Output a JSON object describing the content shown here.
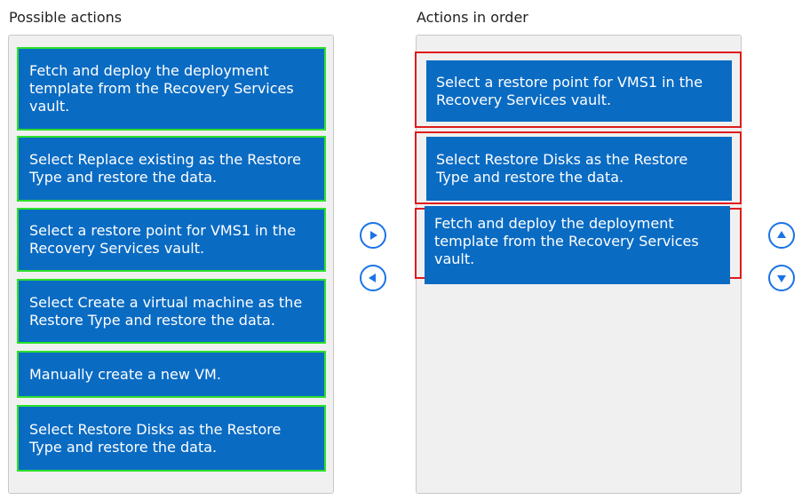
{
  "left": {
    "heading": "Possible actions",
    "items": [
      "Fetch and deploy the deployment template from the Recovery Services vault.",
      "Select Replace existing as the Restore Type and restore the data.",
      "Select a restore point for VMS1 in the Recovery Services vault.",
      "Select Create a virtual machine as the Restore Type and restore the data.",
      "Manually create a new VM.",
      "Select Restore Disks as the Restore Type and restore the data."
    ]
  },
  "right": {
    "heading": "Actions in order",
    "items": [
      "Select a restore point for VMS1 in the Recovery Services vault.",
      "Select Restore Disks as the Restore Type and restore the data.",
      "Fetch and deploy the deployment template from the Recovery Services vault."
    ]
  },
  "controls": {
    "move_right_icon": "play-right-icon",
    "move_left_icon": "play-left-icon",
    "move_up_icon": "arrow-up-icon",
    "move_down_icon": "arrow-down-icon"
  },
  "colors": {
    "item_bg": "#0a6bc3",
    "item_border_left": "#2ce02c",
    "selected_border_right": "#e01b1b",
    "control_stroke": "#1a73e8"
  }
}
